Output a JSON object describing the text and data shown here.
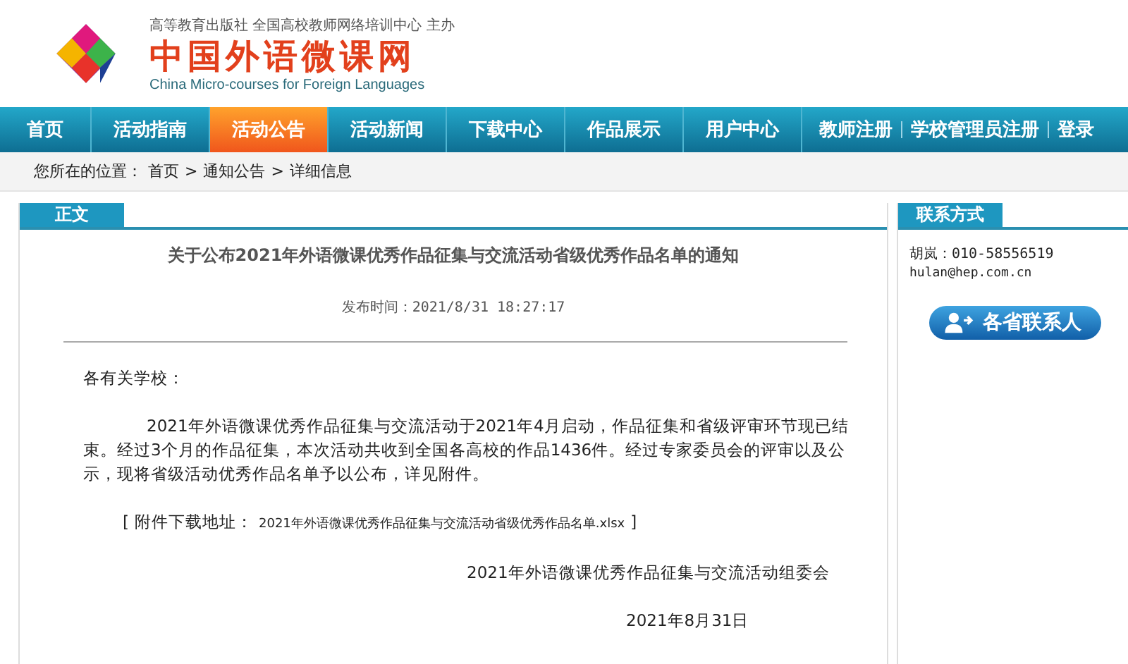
{
  "header": {
    "sponsor": "高等教育出版社 全国高校教师网络培训中心 主办",
    "site_name": "中国外语微课网",
    "site_name_en": "China Micro-courses for Foreign Languages"
  },
  "nav": [
    {
      "label": "首页",
      "selected": false
    },
    {
      "label": "活动指南",
      "selected": false
    },
    {
      "label": "活动公告",
      "selected": true
    },
    {
      "label": "活动新闻",
      "selected": false
    },
    {
      "label": "下载中心",
      "selected": false
    },
    {
      "label": "作品展示",
      "selected": false
    },
    {
      "label": "用户中心",
      "selected": false
    }
  ],
  "account_links": [
    "教师注册",
    "学校管理员注册",
    "登录"
  ],
  "breadcrumb": {
    "prefix": "您所在的位置：",
    "items": [
      "首页",
      "通知公告",
      "详细信息"
    ],
    "separator": ">"
  },
  "article": {
    "tab": "正文",
    "title": "关于公布2021年外语微课优秀作品征集与交流活动省级优秀作品名单的通知",
    "published": "发布时间：2021/8/31 18:27:17",
    "greeting": "各有关学校：",
    "paragraphs": [
      "2021年外语微课优秀作品征集与交流活动于2021年4月启动，作品征集和省级评审环节现已结束。经过3个月的作品征集，本次活动共收到全国各高校的作品1436件。经过专家委员会的评审以及公示，现将省级活动优秀作品名单予以公布，详见附件。"
    ],
    "attachment": {
      "open": "[",
      "label": "附件下载地址：",
      "file": "2021年外语微课优秀作品征集与交流活动省级优秀作品名单.xlsx",
      "close": "]"
    },
    "signature": "2021年外语微课优秀作品征集与交流活动组委会",
    "date": "2021年8月31日"
  },
  "contact": {
    "tab": "联系方式",
    "line": "胡岚：010-58556519",
    "email": "hulan@hep.com.cn",
    "button": "各省联系人"
  }
}
